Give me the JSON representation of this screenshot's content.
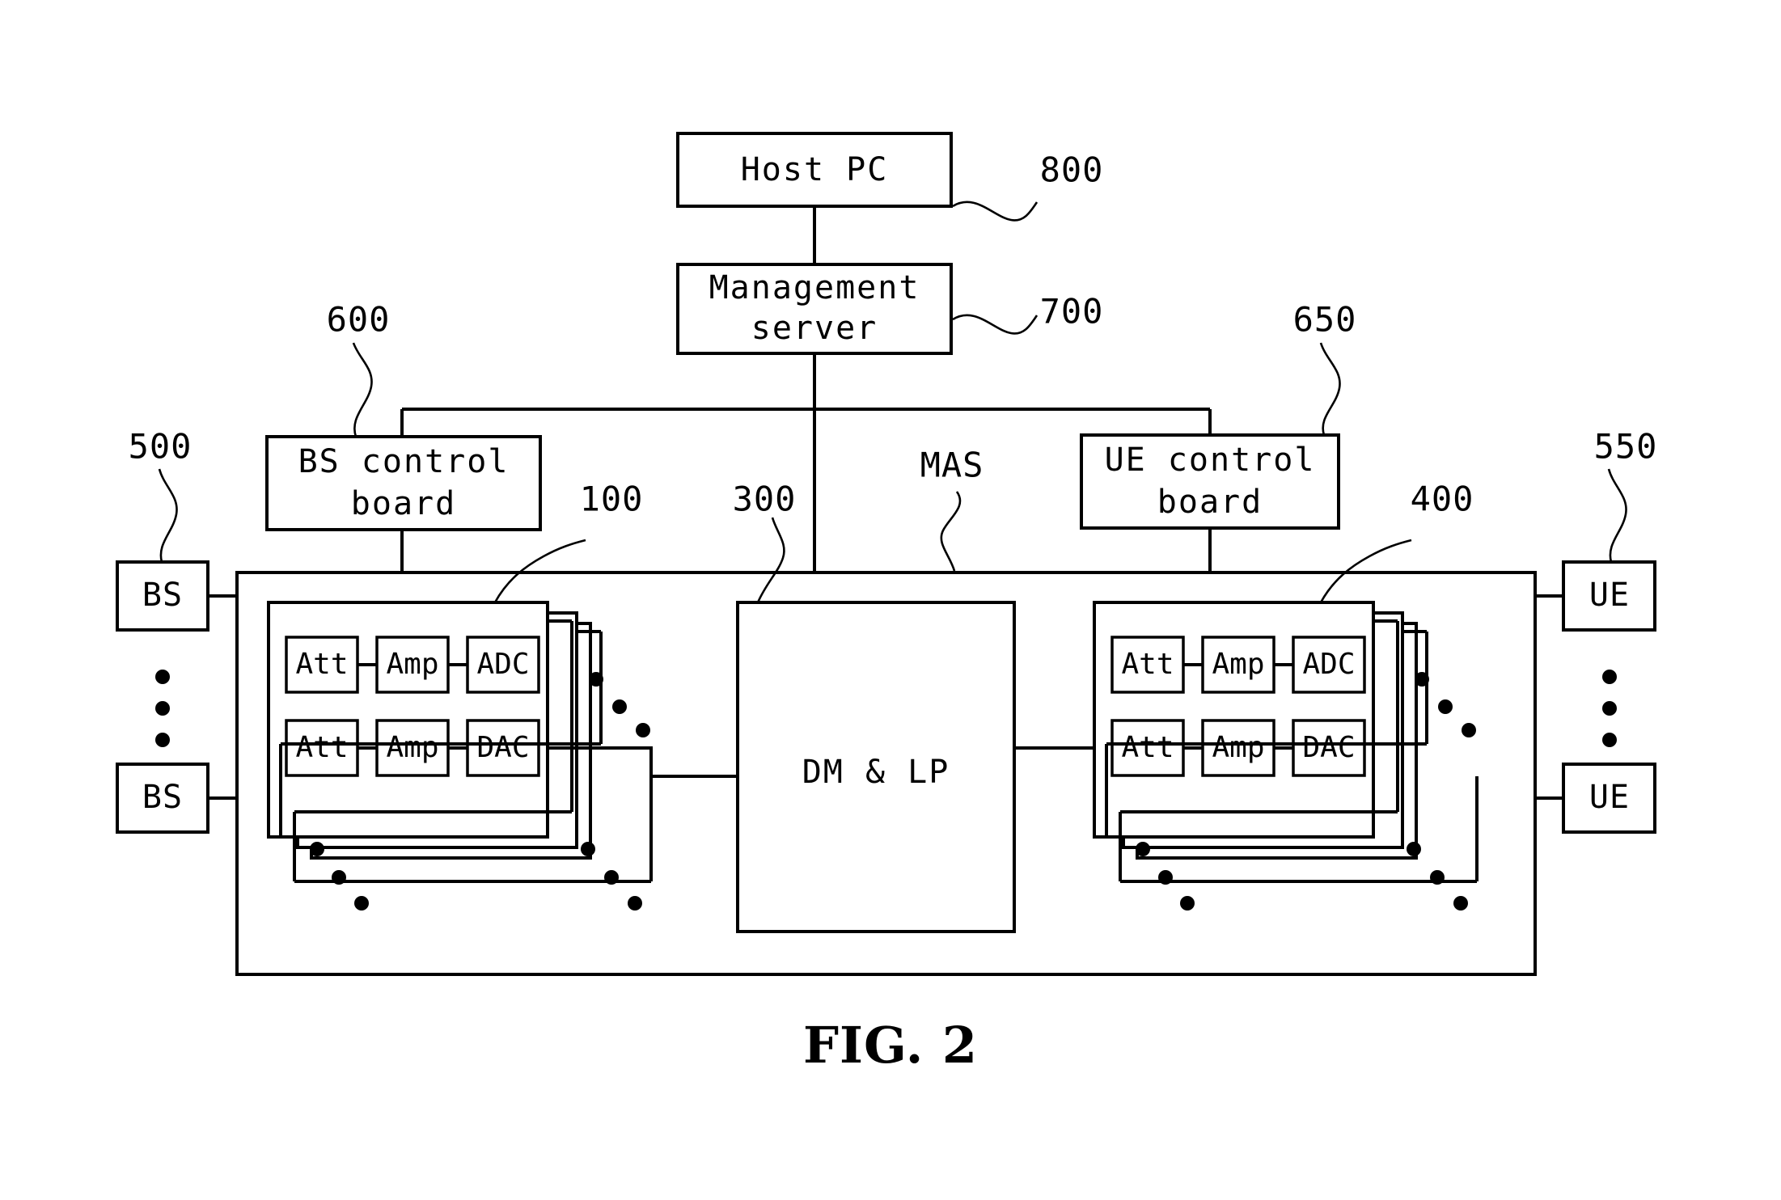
{
  "figure": {
    "caption": "FIG. 2",
    "domain_kind": "patent-block-diagram"
  },
  "nodes": {
    "host_pc": {
      "label": "Host PC",
      "ref": "800"
    },
    "management_server": {
      "label_line1": "Management",
      "label_line2": "server",
      "ref": "700"
    },
    "bs_control_board": {
      "label_line1": "BS control",
      "label_line2": "board",
      "ref": "600"
    },
    "ue_control_board": {
      "label_line1": "UE control",
      "label_line2": "board",
      "ref": "650"
    },
    "dm_lp": {
      "label": "DM & LP",
      "ref": "300"
    },
    "bs_module_stack": {
      "ref": "100"
    },
    "ue_module_stack": {
      "ref": "400"
    },
    "bs_group": {
      "ref": "500"
    },
    "ue_group": {
      "ref": "550"
    },
    "mas_bus": {
      "label": "MAS"
    }
  },
  "endpoints": {
    "bs_top": "BS",
    "bs_bottom": "BS",
    "ue_top": "UE",
    "ue_bottom": "UE"
  },
  "module_chain": {
    "rx_row": [
      "Att",
      "Amp",
      "ADC"
    ],
    "tx_row": [
      "Att",
      "Amp",
      "DAC"
    ]
  },
  "colors": {
    "stroke": "#000000",
    "fill": "#ffffff",
    "background": "#ffffff"
  }
}
